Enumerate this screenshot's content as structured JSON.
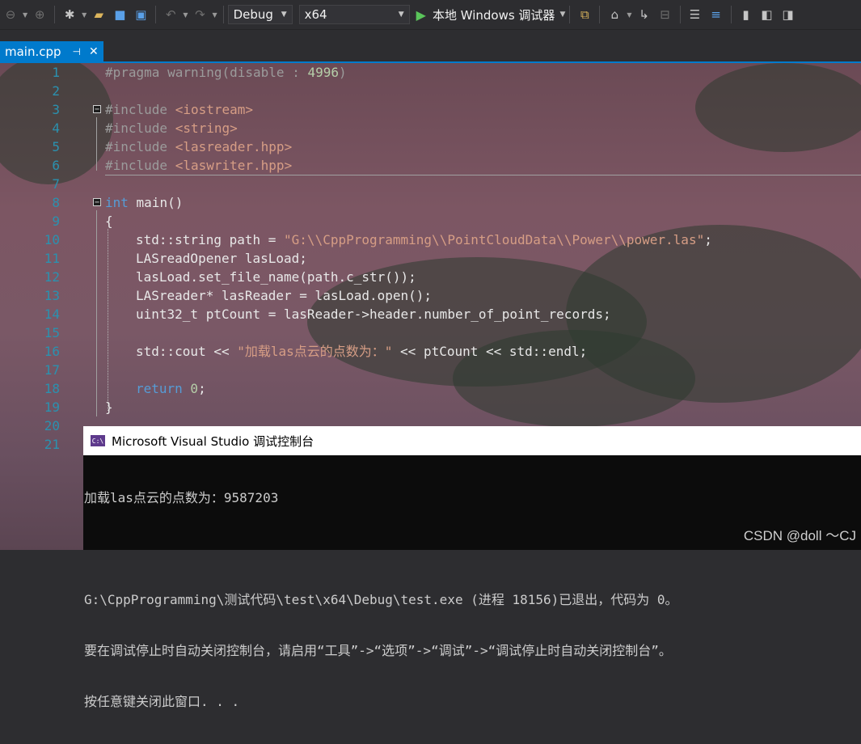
{
  "toolbar": {
    "config": "Debug",
    "platform": "x64",
    "run_label": "本地 Windows 调试器"
  },
  "tab": {
    "filename": "main.cpp",
    "pin": "⊣",
    "close": "✕"
  },
  "code_lines": [
    {
      "n": "1"
    },
    {
      "n": "2"
    },
    {
      "n": "3"
    },
    {
      "n": "4"
    },
    {
      "n": "5"
    },
    {
      "n": "6"
    },
    {
      "n": "7"
    },
    {
      "n": "8"
    },
    {
      "n": "9"
    },
    {
      "n": "10"
    },
    {
      "n": "11"
    },
    {
      "n": "12"
    },
    {
      "n": "13"
    },
    {
      "n": "14"
    },
    {
      "n": "15"
    },
    {
      "n": "16"
    },
    {
      "n": "17"
    },
    {
      "n": "18"
    },
    {
      "n": "19"
    },
    {
      "n": "20"
    },
    {
      "n": "21"
    }
  ],
  "code": {
    "l1_pp": "#pragma warning(disable : ",
    "l1_num": "4996",
    "l1_end": ")",
    "l3_pp": "#include ",
    "l3_str": "<iostream>",
    "l4_pp": "#include ",
    "l4_str": "<string>",
    "l5_pp": "#include ",
    "l5_str": "<lasreader.hpp>",
    "l6_pp": "#include ",
    "l6_str": "<laswriter.hpp>",
    "l8_kw": "int",
    "l8_rest": " main()",
    "l9": "{",
    "l10_a": "std::string path = ",
    "l10_str": "\"G:\\\\CppProgramming\\\\PointCloudData\\\\Power\\\\power.las\"",
    "l10_end": ";",
    "l11": "LASreadOpener lasLoad;",
    "l12": "lasLoad.set_file_name(path.c_str());",
    "l13": "LASreader* lasReader = lasLoad.open();",
    "l14": "uint32_t ptCount = lasReader->header.number_of_point_records;",
    "l16_a": "std::cout << ",
    "l16_str": "\"加载las点云的点数为：\"",
    "l16_b": " << ptCount << std::endl;",
    "l18_kw": "return",
    "l18_num": " 0",
    "l18_end": ";",
    "l19": "}"
  },
  "console": {
    "title": "Microsoft Visual Studio 调试控制台",
    "icon_text": "C:\\",
    "lines": [
      "加载las点云的点数为：9587203",
      "",
      "G:\\CppProgramming\\测试代码\\test\\x64\\Debug\\test.exe (进程 18156)已退出，代码为 0。",
      "要在调试停止时自动关闭控制台，请启用“工具”->“选项”->“调试”->“调试停止时自动关闭控制台”。",
      "按任意键关闭此窗口. . ."
    ]
  },
  "watermark": "CSDN @doll ～CJ"
}
